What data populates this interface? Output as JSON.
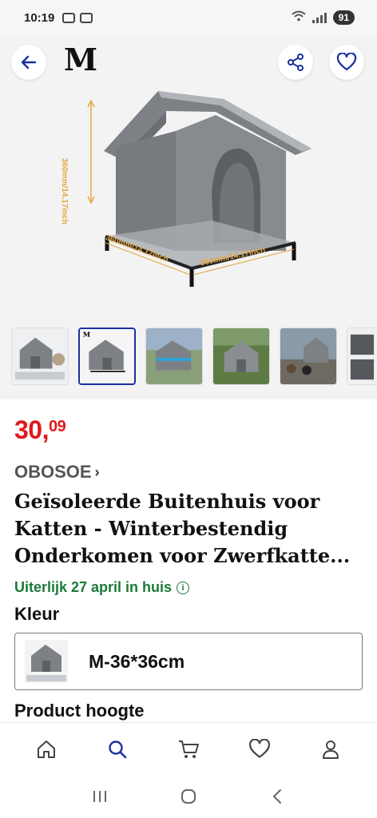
{
  "status_bar": {
    "time": "10:19",
    "battery": "91"
  },
  "header": {
    "brand": "M",
    "back_icon": "arrow-left-icon",
    "share_icon": "share-icon",
    "favorite_icon": "heart-icon"
  },
  "gallery": {
    "dimension_vertical": "360mm/14.17inch",
    "dimension_depth": "360mm/14.17inch",
    "dimension_width": "360mm/14.17inch",
    "thumbnail_count": 6,
    "active_thumbnail": 2
  },
  "product": {
    "price_main": "30,",
    "price_cents": "09",
    "seller": "OBOSOE",
    "title": "Geïsoleerde Buitenhuis voor Katten - Winterbestendig Onderkomen voor Zwerfkatte...",
    "delivery": "Uiterlijk 27 april in huis",
    "color_label": "Kleur",
    "variant": "M-36*36cm",
    "height_label": "Product hoogte"
  },
  "bottom_nav": {
    "items": [
      "home-icon",
      "search-icon",
      "cart-icon",
      "heart-icon",
      "user-icon"
    ],
    "active": "search-icon"
  },
  "system_nav": [
    "recents-icon",
    "home-circle-icon",
    "back-chevron-icon"
  ],
  "colors": {
    "price": "#e0191d",
    "delivery": "#1b7a3a",
    "accent": "#1a2fa0"
  }
}
